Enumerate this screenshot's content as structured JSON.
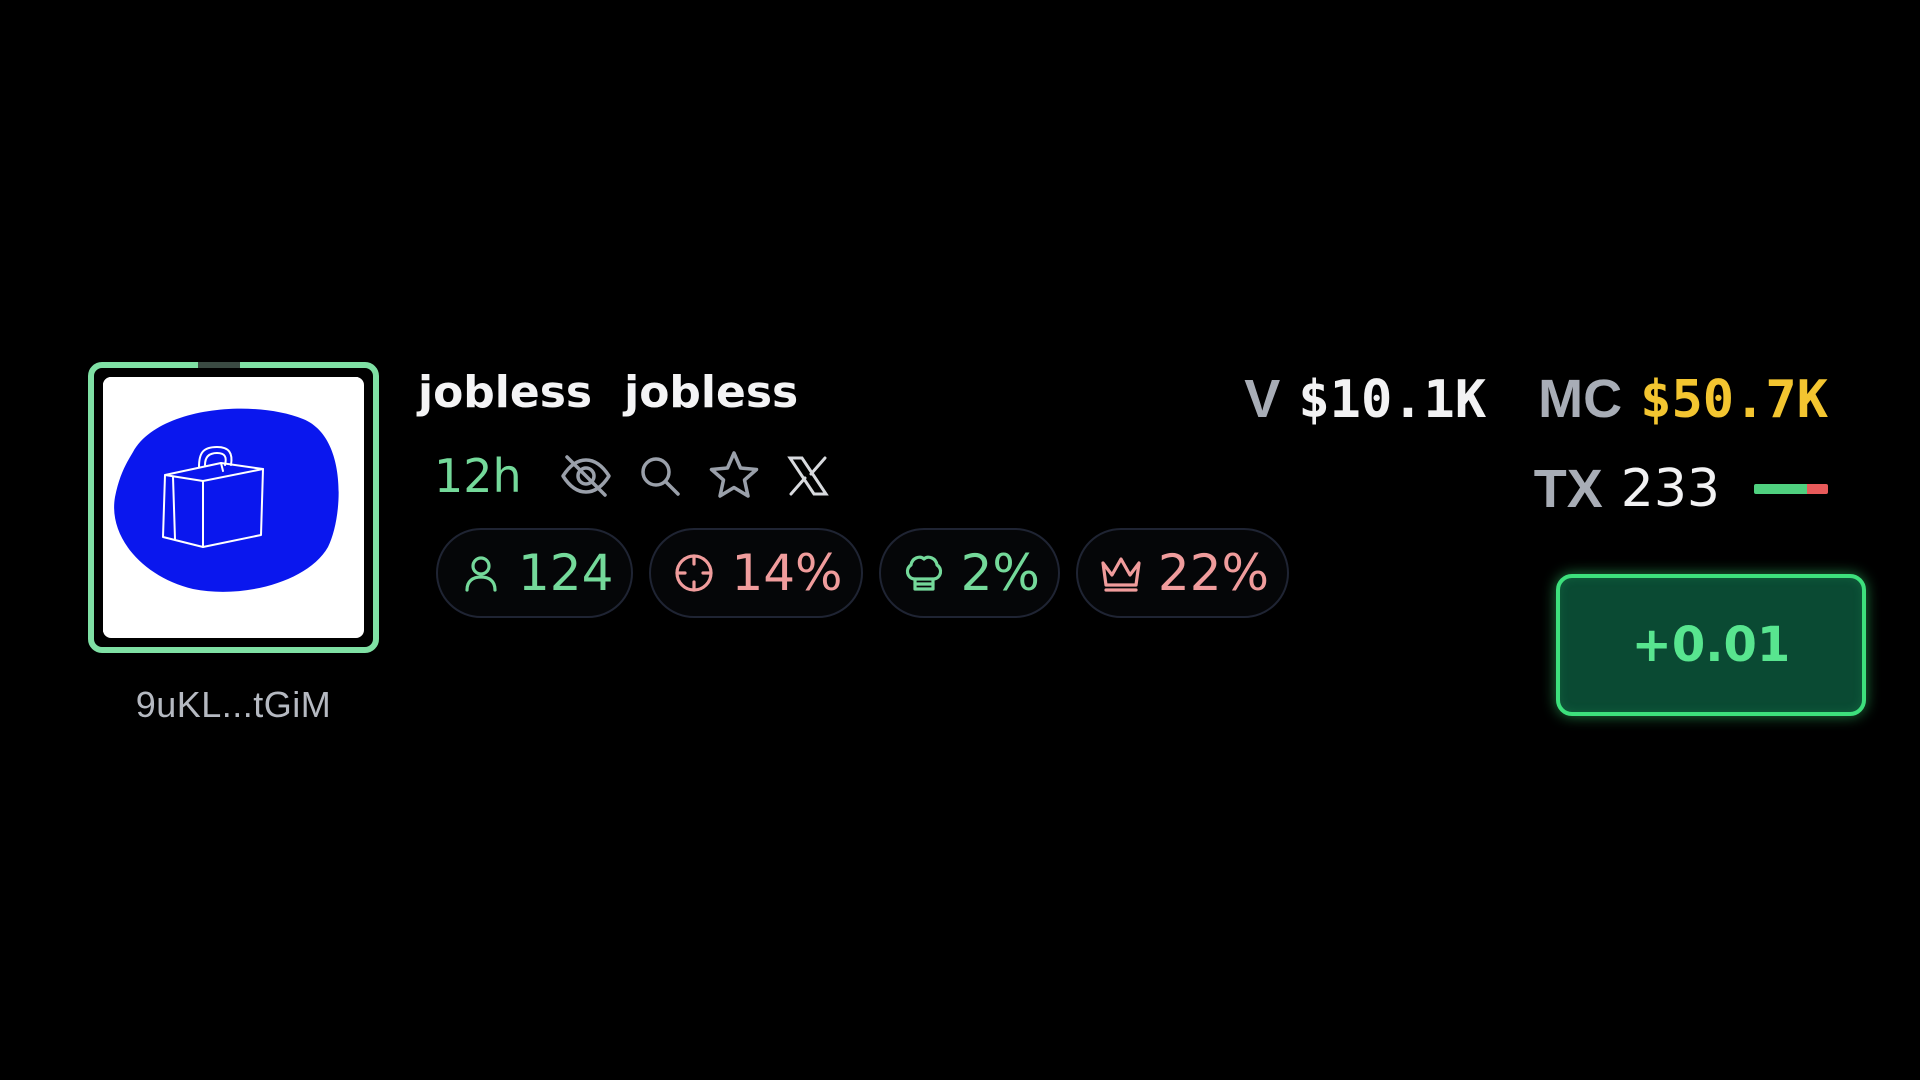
{
  "token": {
    "name": "jobless",
    "symbol": "jobless",
    "address_short": "9uKL...tGiM",
    "age": "12h",
    "avatar": "briefcase-on-blue-blob-image"
  },
  "meta_icons": [
    "eye-off-icon",
    "search-icon",
    "star-icon",
    "x-logo-icon"
  ],
  "pills": {
    "holders": {
      "icon": "user-icon",
      "value": "124"
    },
    "snipers": {
      "icon": "crosshair-icon",
      "value": "14%"
    },
    "dev": {
      "icon": "chef-hat-icon",
      "value": "2%"
    },
    "top10": {
      "icon": "crown-icon",
      "value": "22%"
    }
  },
  "stats": {
    "volume_label": "V",
    "volume_value": "$10.1K",
    "mc_label": "MC",
    "mc_value": "$50.7K",
    "tx_label": "TX",
    "tx_value": "233",
    "buy_sell_ratio": {
      "buy_fraction": 0.72,
      "sell_fraction": 0.28
    }
  },
  "buy_button": {
    "label": "+0.01"
  },
  "colors": {
    "background": "#000000",
    "accent_green": "#74d99a",
    "alert_red": "#f09c9c",
    "mc_gold": "#f3c530",
    "button_fill": "#0a4a33",
    "button_border": "#3de07c"
  }
}
